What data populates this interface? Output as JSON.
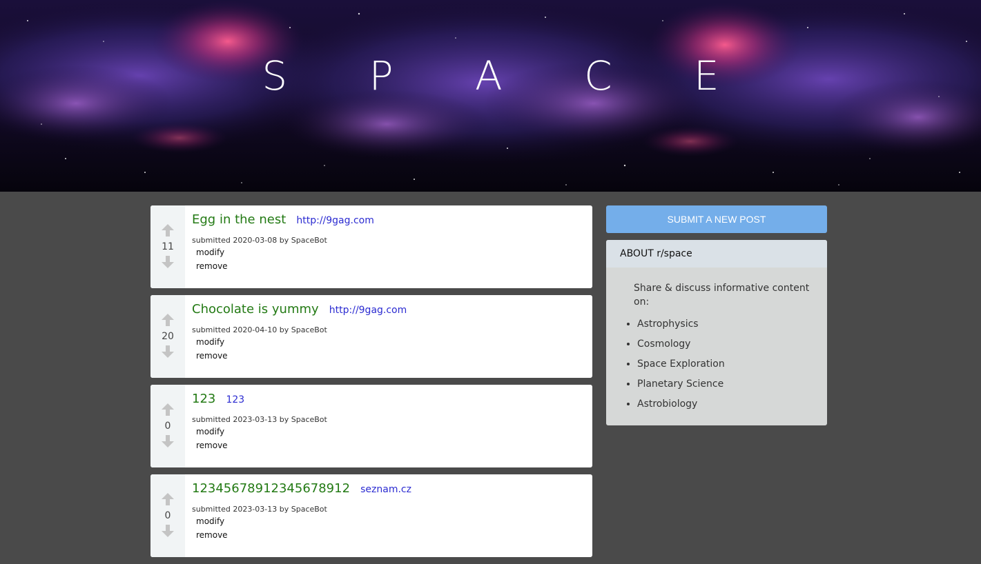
{
  "banner": {
    "title": "S P A C E"
  },
  "posts": [
    {
      "score": "11",
      "title": "Egg in the nest",
      "link": "http://9gag.com",
      "meta": "submitted 2020-03-08 by SpaceBot",
      "modify_label": "modify",
      "remove_label": "remove"
    },
    {
      "score": "20",
      "title": "Chocolate is yummy",
      "link": "http://9gag.com",
      "meta": "submitted 2020-04-10 by SpaceBot",
      "modify_label": "modify",
      "remove_label": "remove"
    },
    {
      "score": "0",
      "title": "123",
      "link": "123",
      "meta": "submitted 2023-03-13 by SpaceBot",
      "modify_label": "modify",
      "remove_label": "remove"
    },
    {
      "score": "0",
      "title": "12345678912345678912",
      "link": "seznam.cz",
      "meta": "submitted 2023-03-13 by SpaceBot",
      "modify_label": "modify",
      "remove_label": "remove"
    }
  ],
  "sidebar": {
    "submit_label": "SUBMIT A NEW POST",
    "about_title": "ABOUT r/space",
    "about_desc": "Share & discuss informative content on:",
    "topics": [
      "Astrophysics",
      "Cosmology",
      "Space Exploration",
      "Planetary Science",
      "Astrobiology"
    ]
  },
  "colors": {
    "page_bg": "#4a4a4a",
    "title_green": "#237a14",
    "link_blue": "#2b2bd1",
    "submit_blue": "#74aeea",
    "vote_bg": "#f1f4f5",
    "arrow_gray": "#c4c4c4"
  },
  "icons": {
    "upvote": "arrow-up-icon",
    "downvote": "arrow-down-icon"
  }
}
